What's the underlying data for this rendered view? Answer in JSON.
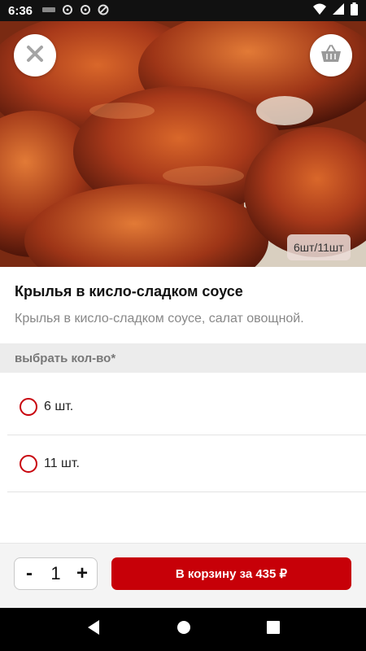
{
  "status_bar": {
    "time": "6:36",
    "left_icons": [
      "notification-icon",
      "settings-icon",
      "settings-icon",
      "sync-off-icon"
    ],
    "right_icons": [
      "wifi-icon",
      "signal-icon",
      "battery-icon"
    ]
  },
  "hero": {
    "close_icon": "close-icon",
    "basket_icon": "basket-icon",
    "portion_badge": "6шт/11шт"
  },
  "product": {
    "title": "Крылья в кисло-сладком соусе",
    "description": "Крылья в кисло-сладком соусе, салат овощной."
  },
  "options": {
    "header": "выбрать кол-во*",
    "items": [
      {
        "label": "6 шт."
      },
      {
        "label": "11 шт."
      }
    ]
  },
  "action_bar": {
    "minus": "-",
    "quantity": "1",
    "plus": "+",
    "cart_label": "В корзину за 435 ₽"
  },
  "colors": {
    "accent": "#c70008",
    "radio": "#c8050e"
  },
  "nav": {
    "back_icon": "back-icon",
    "home_icon": "home-icon",
    "recents_icon": "recents-icon"
  }
}
